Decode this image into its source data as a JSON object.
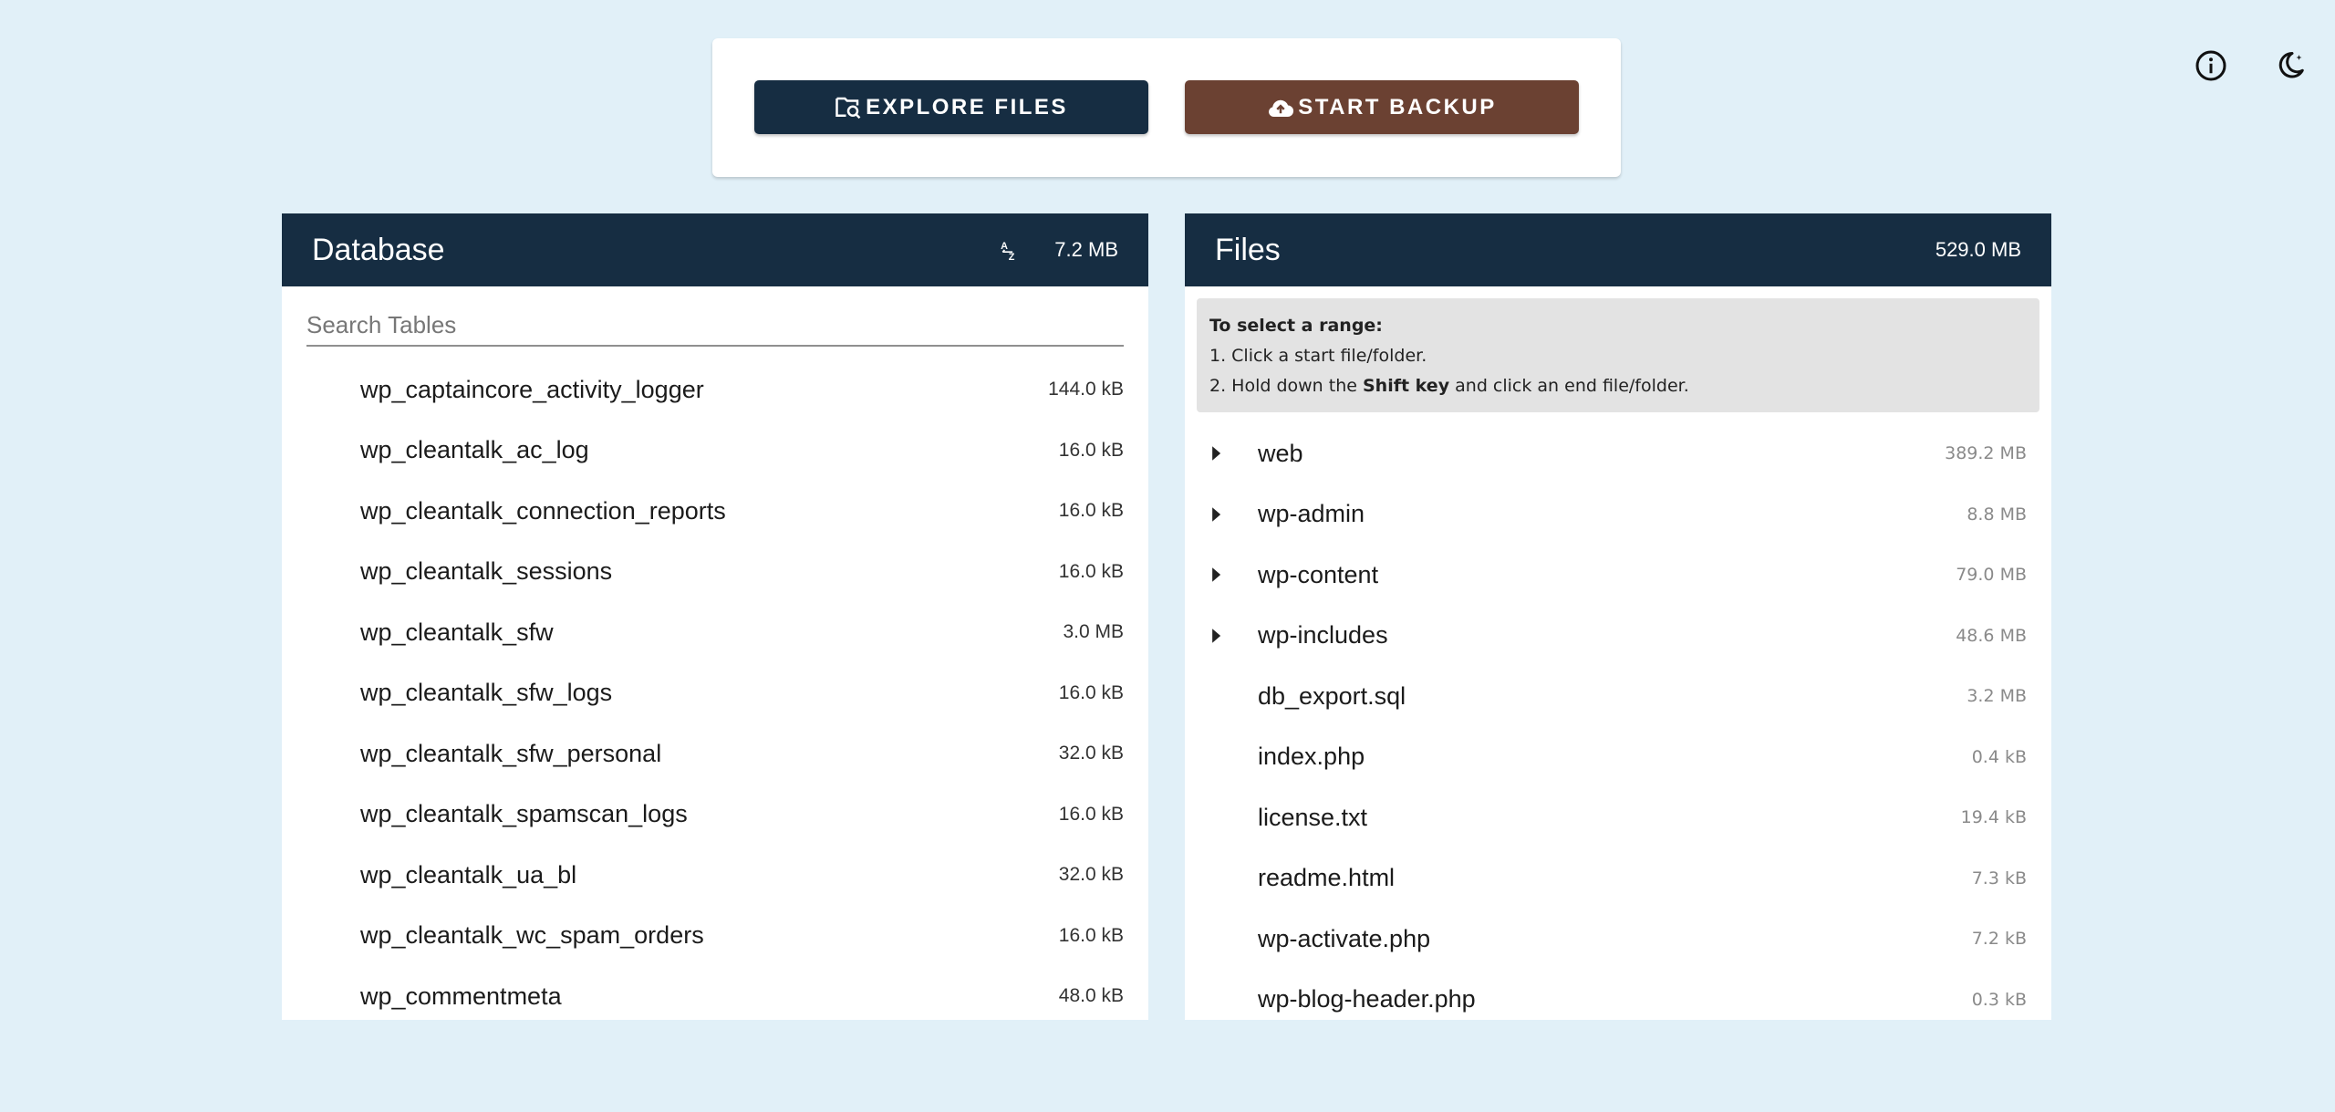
{
  "actions": {
    "explore_label": "EXPLORE FILES",
    "backup_label": "START BACKUP"
  },
  "top_icons": [
    "info-icon",
    "moon-icon"
  ],
  "database": {
    "title": "Database",
    "total_size": "7.2 MB",
    "search_placeholder": "Search Tables",
    "tables": [
      {
        "name": "wp_captaincore_activity_logger",
        "size": "144.0 kB"
      },
      {
        "name": "wp_cleantalk_ac_log",
        "size": "16.0 kB"
      },
      {
        "name": "wp_cleantalk_connection_reports",
        "size": "16.0 kB"
      },
      {
        "name": "wp_cleantalk_sessions",
        "size": "16.0 kB"
      },
      {
        "name": "wp_cleantalk_sfw",
        "size": "3.0 MB"
      },
      {
        "name": "wp_cleantalk_sfw_logs",
        "size": "16.0 kB"
      },
      {
        "name": "wp_cleantalk_sfw_personal",
        "size": "32.0 kB"
      },
      {
        "name": "wp_cleantalk_spamscan_logs",
        "size": "16.0 kB"
      },
      {
        "name": "wp_cleantalk_ua_bl",
        "size": "32.0 kB"
      },
      {
        "name": "wp_cleantalk_wc_spam_orders",
        "size": "16.0 kB"
      },
      {
        "name": "wp_commentmeta",
        "size": "48.0 kB"
      }
    ]
  },
  "files": {
    "title": "Files",
    "total_size": "529.0 MB",
    "range_help": {
      "heading": "To select a range:",
      "step1": "1. Click a start file/folder.",
      "step2_prefix": "2. Hold down the ",
      "step2_key": "Shift key",
      "step2_suffix": " and click an end file/folder."
    },
    "items": [
      {
        "name": "web",
        "size": "389.2 MB",
        "folder": true
      },
      {
        "name": "wp-admin",
        "size": "8.8 MB",
        "folder": true
      },
      {
        "name": "wp-content",
        "size": "79.0 MB",
        "folder": true
      },
      {
        "name": "wp-includes",
        "size": "48.6 MB",
        "folder": true
      },
      {
        "name": "db_export.sql",
        "size": "3.2 MB",
        "folder": false
      },
      {
        "name": "index.php",
        "size": "0.4 kB",
        "folder": false
      },
      {
        "name": "license.txt",
        "size": "19.4 kB",
        "folder": false
      },
      {
        "name": "readme.html",
        "size": "7.3 kB",
        "folder": false
      },
      {
        "name": "wp-activate.php",
        "size": "7.2 kB",
        "folder": false
      },
      {
        "name": "wp-blog-header.php",
        "size": "0.3 kB",
        "folder": false
      }
    ]
  }
}
